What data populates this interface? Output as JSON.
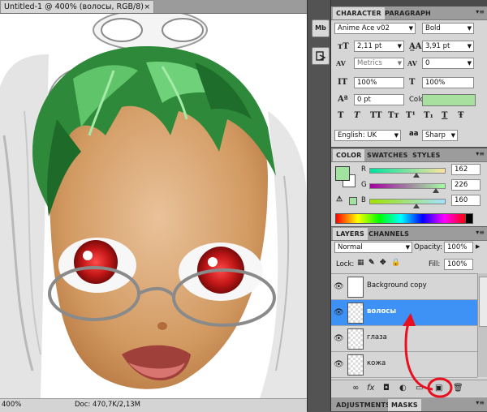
{
  "document": {
    "tab_title": "Untitled-1 @ 400% (волосы, RGB/8)",
    "close_glyph": "×",
    "zoom": "400%",
    "doc_info": "Doc: 470,7K/2,13M"
  },
  "character_panel": {
    "tabs": [
      "CHARACTER",
      "PARAGRAPH"
    ],
    "font_family": "Anime Ace v02",
    "font_style": "Bold",
    "font_size": "2,11 pt",
    "leading": "3,91 pt",
    "kerning": "Metrics",
    "tracking": "0",
    "vertical_scale": "100%",
    "horizontal_scale": "100%",
    "baseline_shift": "0 pt",
    "color_label": "Color:",
    "text_color": "#a7e09f",
    "style_buttons": [
      "T",
      "T",
      "TT",
      "Tт",
      "T¹",
      "T₁",
      "T",
      "Ŧ"
    ],
    "language": "English: UK",
    "antialias_label": "aa",
    "antialias": "Sharp"
  },
  "color_panel": {
    "tabs": [
      "COLOR",
      "SWATCHES",
      "STYLES"
    ],
    "channels": [
      {
        "label": "R",
        "value": "162",
        "fraction": 0.635
      },
      {
        "label": "G",
        "value": "226",
        "fraction": 0.886
      },
      {
        "label": "B",
        "value": "160",
        "fraction": 0.627
      }
    ],
    "foreground": "#a2e2a0",
    "background": "#ffffff"
  },
  "layers_panel": {
    "tabs": [
      "LAYERS",
      "CHANNELS"
    ],
    "blend_mode": "Normal",
    "opacity_label": "Opacity:",
    "opacity": "100%",
    "lock_label": "Lock:",
    "fill_label": "Fill:",
    "fill": "100%",
    "layers": [
      {
        "name": "Background copy",
        "selected": false
      },
      {
        "name": "волосы",
        "selected": true
      },
      {
        "name": "глаза",
        "selected": false
      },
      {
        "name": "кожа",
        "selected": false
      }
    ],
    "footer_buttons": [
      "link-icon",
      "fx-icon",
      "mask-icon",
      "adjustment-icon",
      "group-icon",
      "new-layer-icon",
      "trash-icon"
    ]
  },
  "bottom_panel": {
    "tabs": [
      "ADJUSTMENTS",
      "MASKS"
    ]
  },
  "dock": {
    "buttons": [
      "Mb",
      "history"
    ]
  },
  "colors": {
    "accent_selected": "#3f92f5",
    "annotation_red": "#e8101e",
    "hair_green": "#2e8a3a"
  }
}
